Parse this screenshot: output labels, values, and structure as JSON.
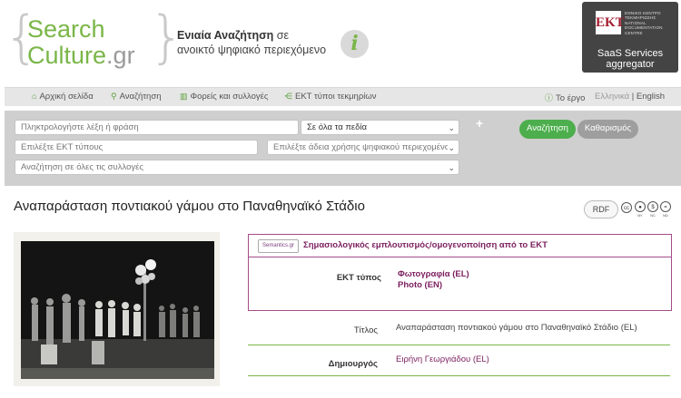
{
  "header": {
    "logo_line1": "Search",
    "logo_line2": "Culture",
    "logo_suffix": ".gr",
    "tagline_bold": "Ενιαία Αναζήτηση",
    "tagline_rest": " σε",
    "tagline_line2": "ανοικτό ψηφιακό περιεχόμενο",
    "info_glyph": "i",
    "ekt": {
      "mark": "EKT",
      "line1": "ΕΘΝΙΚΟ ΚΕΝΤΡΟ",
      "line2": "ΤΕΚΜΗΡΙΩΣΗΣ",
      "line3": "NATIONAL",
      "line4": "DOCUMENTATION",
      "line5": "CENTRE",
      "services": "SaaS Services",
      "aggregator": "aggregator"
    }
  },
  "nav": {
    "items": [
      {
        "icon": "home-icon",
        "label": "Αρχική σελίδα"
      },
      {
        "icon": "search-icon",
        "label": "Αναζήτηση"
      },
      {
        "icon": "institution-icon",
        "label": "Φορείς και συλλογές"
      },
      {
        "icon": "tree-icon",
        "label": "ΕΚΤ τύποι τεκμηρίων"
      }
    ],
    "about": "Το έργο",
    "lang_el": "Ελληνικά",
    "lang_sep": "|",
    "lang_en": "English",
    "accent": "#5a9e3a"
  },
  "search": {
    "query_placeholder": "Πληκτρολογήστε λέξη ή φράση",
    "field_select": "Σε όλα τα πεδία",
    "ekt_types_placeholder": "Επιλέξτε ΕΚΤ τύπους",
    "license_placeholder": "Επιλέξτε άδεια χρήσης ψηφιακού περιεχομένου",
    "collections_placeholder": "Αναζήτηση σε όλες τις συλλογές",
    "plus": "+",
    "search_button": "Αναζήτηση",
    "clear_button": "Καθαρισμός",
    "search_color": "#4cae4c",
    "clear_color": "#9e9e9e"
  },
  "record": {
    "title": "Αναπαράσταση ποντιακού γάμου στο Παναθηναϊκό Στάδιο",
    "rdf": "RDF",
    "license_icons": [
      "cc",
      "by",
      "nc",
      "nd"
    ],
    "license_labels": [
      "",
      "BY",
      "NC",
      "ND"
    ],
    "semantics_badge": "Semantics.gr",
    "semantics_title": "Σημασιολογικός εμπλουτισμός/ομογενοποίηση από το ΕΚΤ",
    "ekt_type_label": "ΕΚΤ τύπος",
    "ekt_type_values": [
      "Φωτογραφία (EL)",
      "Photo (EN)"
    ],
    "fields": [
      {
        "label": "Τίτλος",
        "value": "Αναπαράσταση ποντιακού γάμου στο Παναθηναϊκό Στάδιο (EL)"
      },
      {
        "label": "Δημιουργός",
        "value": "Ειρήνη Γεωργιάδου (EL)"
      }
    ],
    "semantic_color": "#a54c8a"
  }
}
